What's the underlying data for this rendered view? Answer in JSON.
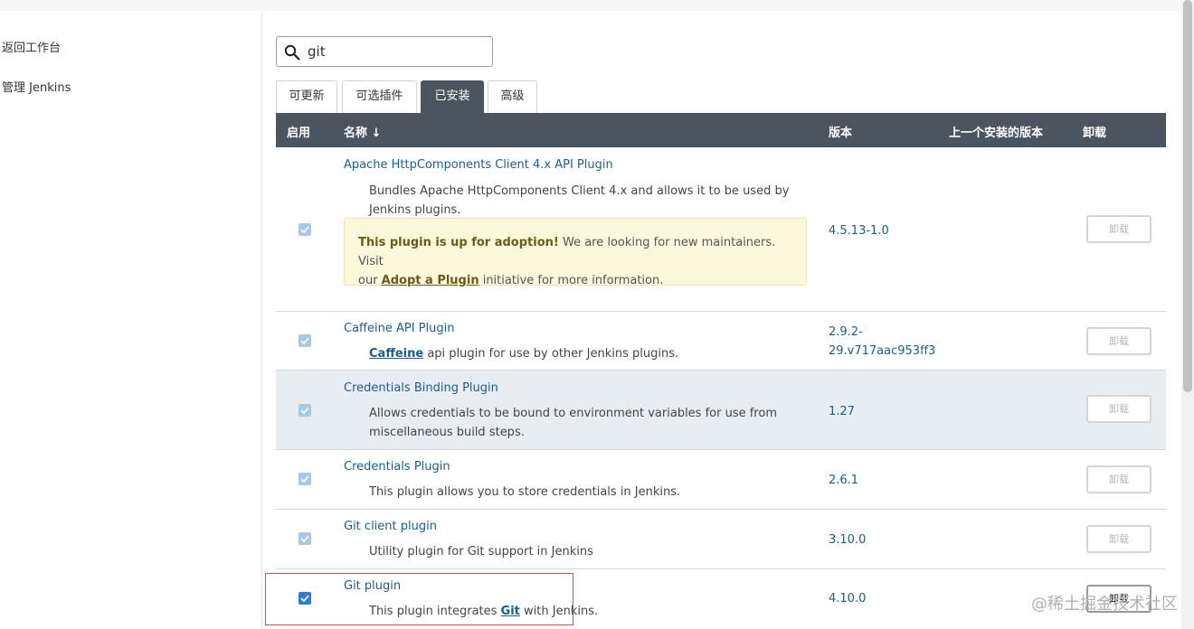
{
  "sidebar": {
    "back_label": "返回工作台",
    "manage_label": "管理 Jenkins"
  },
  "search": {
    "value": "git"
  },
  "tabs": [
    {
      "label": "可更新",
      "active": false
    },
    {
      "label": "可选插件",
      "active": false
    },
    {
      "label": "已安装",
      "active": true
    },
    {
      "label": "高级",
      "active": false
    }
  ],
  "table": {
    "headers": {
      "enabled": "启用",
      "name": "名称 ↓",
      "version": "版本",
      "previous": "上一个安装的版本",
      "uninstall": "卸载"
    },
    "rows": [
      {
        "name": "Apache HttpComponents Client 4.x API Plugin",
        "desc_line1": "Bundles Apache HttpComponents Client 4.x and allows it to be used by",
        "desc_line2": "Jenkins plugins.",
        "version": "4.5.13-1.0",
        "uninstall": "卸载",
        "adoption": {
          "bold": "This plugin is up for adoption!",
          "text1": " We are looking for new maintainers. Visit",
          "text2_pre": "our ",
          "link": "Adopt a Plugin",
          "text2_post": " initiative for more information."
        }
      },
      {
        "name": "Caffeine API Plugin",
        "desc_link": "Caffeine",
        "desc_rest": " api plugin for use by other Jenkins plugins.",
        "version_line1": "2.9.2-",
        "version_line2": "29.v717aac953ff3",
        "uninstall": "卸载"
      },
      {
        "name": "Credentials Binding Plugin",
        "desc_line1": "Allows credentials to be bound to environment variables for use from",
        "desc_line2": "miscellaneous build steps.",
        "version": "1.27",
        "uninstall": "卸载"
      },
      {
        "name": "Credentials Plugin",
        "desc": "This plugin allows you to store credentials in Jenkins.",
        "version": "2.6.1",
        "uninstall": "卸载"
      },
      {
        "name": "Git client plugin",
        "desc": "Utility plugin for Git support in Jenkins",
        "version": "3.10.0",
        "uninstall": "卸载"
      },
      {
        "name": "Git plugin",
        "desc_pre": "This plugin integrates ",
        "desc_link": "Git",
        "desc_post": " with Jenkins.",
        "version": "4.10.0",
        "uninstall": "卸载"
      }
    ]
  },
  "watermark": "@稀土掘金技术社区",
  "colors": {
    "header_bg": "#4b5560",
    "link": "#1c5e8a",
    "row_shaded": "#e8edf1",
    "adoption_bg": "#fdf8dc",
    "highlight_border": "#e0474c"
  }
}
